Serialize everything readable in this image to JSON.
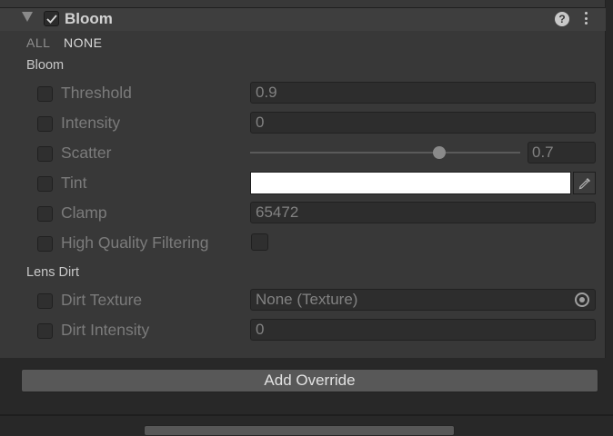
{
  "header": {
    "title": "Bloom",
    "enabled": true,
    "help_glyph": "?"
  },
  "toggles": {
    "all_label": "ALL",
    "none_label": "NONE"
  },
  "sections": {
    "bloom_label": "Bloom",
    "lens_dirt_label": "Lens Dirt"
  },
  "properties": {
    "threshold": {
      "label": "Threshold",
      "value": "0.9"
    },
    "intensity": {
      "label": "Intensity",
      "value": "0"
    },
    "scatter": {
      "label": "Scatter",
      "value": "0.7",
      "slider_fraction": 0.7
    },
    "tint": {
      "label": "Tint",
      "color": "#ffffff"
    },
    "clamp": {
      "label": "Clamp",
      "value": "65472"
    },
    "high_quality_filtering": {
      "label": "High Quality Filtering",
      "checked": false
    },
    "dirt_texture": {
      "label": "Dirt Texture",
      "value": "None (Texture)"
    },
    "dirt_intensity": {
      "label": "Dirt Intensity",
      "value": "0"
    }
  },
  "footer": {
    "add_override_label": "Add Override"
  },
  "colors": {
    "panel_bg": "#383838",
    "header_bg": "#3e3e3e",
    "field_bg": "#2d2d2d",
    "button_bg": "#585858"
  }
}
